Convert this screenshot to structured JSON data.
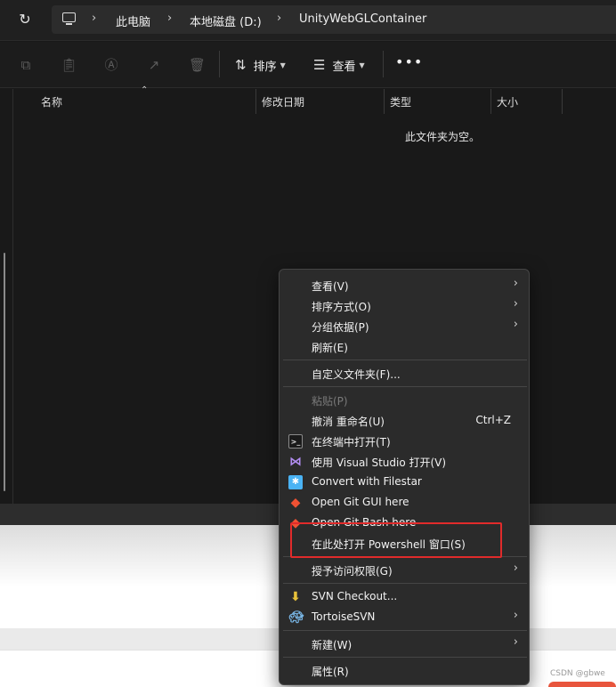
{
  "address": {
    "crumbs": [
      "此电脑",
      "本地磁盘 (D:)",
      "UnityWebGLContainer"
    ]
  },
  "toolbar": {
    "sort_label": "排序",
    "view_label": "查看",
    "more_label": "•••"
  },
  "columns": [
    "名称",
    "修改日期",
    "类型",
    "大小"
  ],
  "empty_message": "此文件夹为空。",
  "context_menu": {
    "view": "查看(V)",
    "sort_by": "排序方式(O)",
    "group_by": "分组依据(P)",
    "refresh": "刷新(E)",
    "customize": "自定义文件夹(F)...",
    "paste": "粘贴(P)",
    "undo_rename": "撤消 重命名(U)",
    "undo_shortcut": "Ctrl+Z",
    "open_terminal": "在终端中打开(T)",
    "open_vs": "使用 Visual Studio 打开(V)",
    "filestar": "Convert with Filestar",
    "git_gui": "Open Git GUI here",
    "git_bash": "Open Git Bash here",
    "powershell": "在此处打开 Powershell 窗口(S)",
    "give_access": "授予访问权限(G)",
    "svn_checkout": "SVN Checkout...",
    "tortoise_svn": "TortoiseSVN",
    "new": "新建(W)",
    "properties": "属性(R)"
  },
  "watermark": "CSDN @gbwe",
  "colors": {
    "highlight": "#e12b2b",
    "menu_bg": "#2b2b2b",
    "window_bg": "#191919"
  }
}
